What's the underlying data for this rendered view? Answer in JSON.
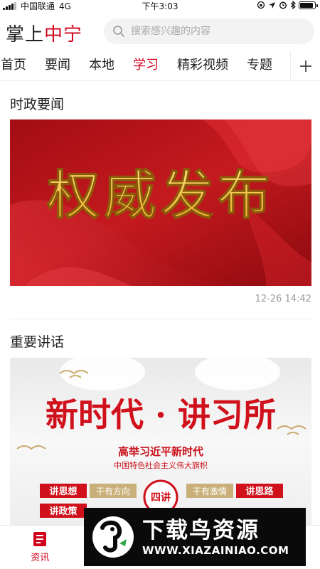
{
  "status_bar": {
    "carrier": "中国联通",
    "network": "4G",
    "time": "下午3:03"
  },
  "header": {
    "logo_part1": "掌上",
    "logo_part2": "中宁",
    "search_placeholder": "搜索感兴趣的内容"
  },
  "tabs": [
    {
      "label": "首页",
      "active": false
    },
    {
      "label": "要闻",
      "active": false
    },
    {
      "label": "本地",
      "active": false
    },
    {
      "label": "学习",
      "active": true
    },
    {
      "label": "精彩视频",
      "active": false
    },
    {
      "label": "专题",
      "active": false
    }
  ],
  "icons": {
    "search": "search-icon",
    "plus": "plus-icon",
    "news": "news-icon"
  },
  "colors": {
    "accent": "#d0021b",
    "banner_red": "#b3121a",
    "gold": "#f7d24a"
  },
  "sections": [
    {
      "title": "时政要闻",
      "image_text": "权威发布",
      "timestamp": "12-26 14:42"
    },
    {
      "title": "重要讲话",
      "image_title": "新时代 · 讲习所",
      "image_subtitle": "高举习近平新时代",
      "image_subtitle2": "中国特色社会主义伟大旗帜",
      "badges_left": [
        "讲思想",
        "讲政策"
      ],
      "badges_mid": [
        "干有方向",
        "干有激情"
      ],
      "badge_right": "讲思路",
      "center_badge": "四讲"
    }
  ],
  "bottom_nav": [
    {
      "label": "资讯",
      "active": true
    },
    {
      "label": "",
      "active": false
    },
    {
      "label": "",
      "active": false
    },
    {
      "label": "",
      "active": false
    }
  ],
  "watermark": {
    "text": "下载鸟资源",
    "url": "WWW.XIAZAINIAO.COM"
  }
}
